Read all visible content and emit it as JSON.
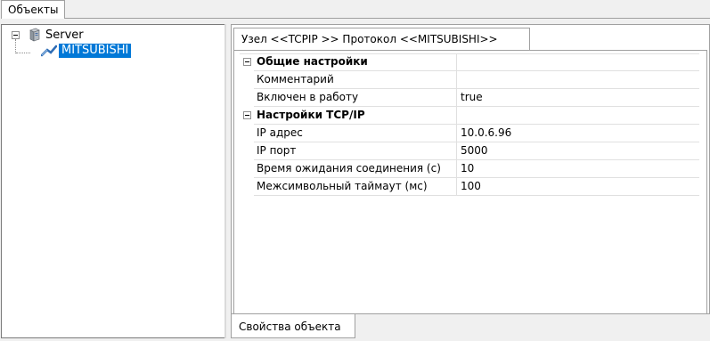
{
  "window": {
    "top_tab_label": "Объекты"
  },
  "tree": {
    "root": {
      "label": "Server",
      "icon": "server-icon"
    },
    "children": [
      {
        "label": "MITSUBISHI",
        "icon": "protocol-node-icon",
        "selected": true
      }
    ]
  },
  "properties": {
    "tab_label": "Узел <<TCPIP  >> Протокол <<MITSUBISHI>>",
    "categories": [
      {
        "name": "Общие настройки",
        "rows": [
          {
            "name": "Комментарий",
            "value": ""
          },
          {
            "name": "Включен в работу",
            "value": "true"
          }
        ]
      },
      {
        "name": "Настройки TCP/IP",
        "rows": [
          {
            "name": "IP адрес",
            "value": "10.0.6.96"
          },
          {
            "name": "IP порт",
            "value": "5000"
          },
          {
            "name": "Время ожидания соединения (с)",
            "value": "10"
          },
          {
            "name": "Межсимвольный таймаут (мс)",
            "value": "100"
          }
        ]
      }
    ],
    "bottom_tab_label": "Свойства объекта"
  },
  "colors": {
    "selection": "#0078d7",
    "background": "#f0f0f0",
    "grid_line": "#e0e0e0"
  }
}
